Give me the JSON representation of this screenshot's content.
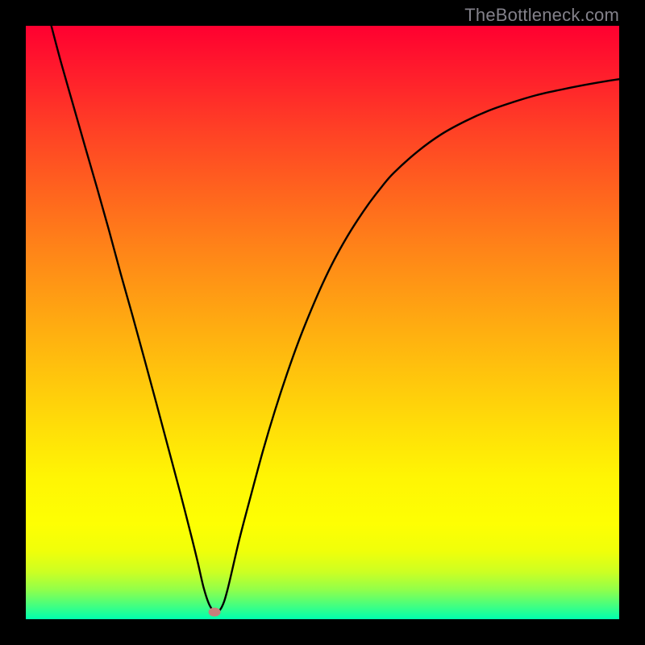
{
  "watermark": "TheBottleneck.com",
  "chart_data": {
    "type": "line",
    "title": "",
    "xlabel": "",
    "ylabel": "",
    "xlim": [
      0,
      100
    ],
    "ylim": [
      0,
      100
    ],
    "grid": false,
    "legend": false,
    "series": [
      {
        "name": "curve",
        "color": "#000000",
        "x": [
          4.3,
          6,
          8,
          10,
          12,
          14,
          16,
          18,
          20,
          22,
          24,
          26,
          28,
          29,
          30,
          31,
          32,
          33,
          34,
          36,
          38,
          40,
          42,
          44,
          46,
          48,
          50,
          52,
          54,
          56,
          58,
          60,
          62,
          66,
          70,
          74,
          78,
          82,
          86,
          90,
          94,
          98,
          100
        ],
        "y": [
          100,
          93.6,
          86.6,
          79.6,
          72.7,
          65.6,
          58.2,
          51.1,
          43.8,
          36.4,
          28.9,
          21.4,
          13.6,
          9.5,
          5.2,
          2.3,
          1.2,
          2.0,
          5.0,
          13.5,
          21.1,
          28.5,
          35.2,
          41.3,
          46.9,
          51.9,
          56.5,
          60.6,
          64.2,
          67.4,
          70.3,
          72.9,
          75.2,
          78.8,
          81.7,
          83.9,
          85.7,
          87.1,
          88.3,
          89.2,
          90.0,
          90.7,
          91.0
        ]
      }
    ],
    "marker": {
      "x": 31.8,
      "y": 1.2,
      "color": "#c87f7b"
    },
    "background_gradient": {
      "stops": [
        {
          "offset": 0.0,
          "color": "#ff0030"
        },
        {
          "offset": 0.08,
          "color": "#ff1d2c"
        },
        {
          "offset": 0.18,
          "color": "#ff4225"
        },
        {
          "offset": 0.28,
          "color": "#ff641e"
        },
        {
          "offset": 0.38,
          "color": "#ff8518"
        },
        {
          "offset": 0.48,
          "color": "#ffa412"
        },
        {
          "offset": 0.58,
          "color": "#ffc20d"
        },
        {
          "offset": 0.68,
          "color": "#ffdf08"
        },
        {
          "offset": 0.76,
          "color": "#fff504"
        },
        {
          "offset": 0.84,
          "color": "#feff03"
        },
        {
          "offset": 0.885,
          "color": "#f0ff0a"
        },
        {
          "offset": 0.92,
          "color": "#cdff22"
        },
        {
          "offset": 0.95,
          "color": "#92ff4a"
        },
        {
          "offset": 0.975,
          "color": "#49ff7c"
        },
        {
          "offset": 1.0,
          "color": "#00ffaf"
        }
      ]
    }
  }
}
